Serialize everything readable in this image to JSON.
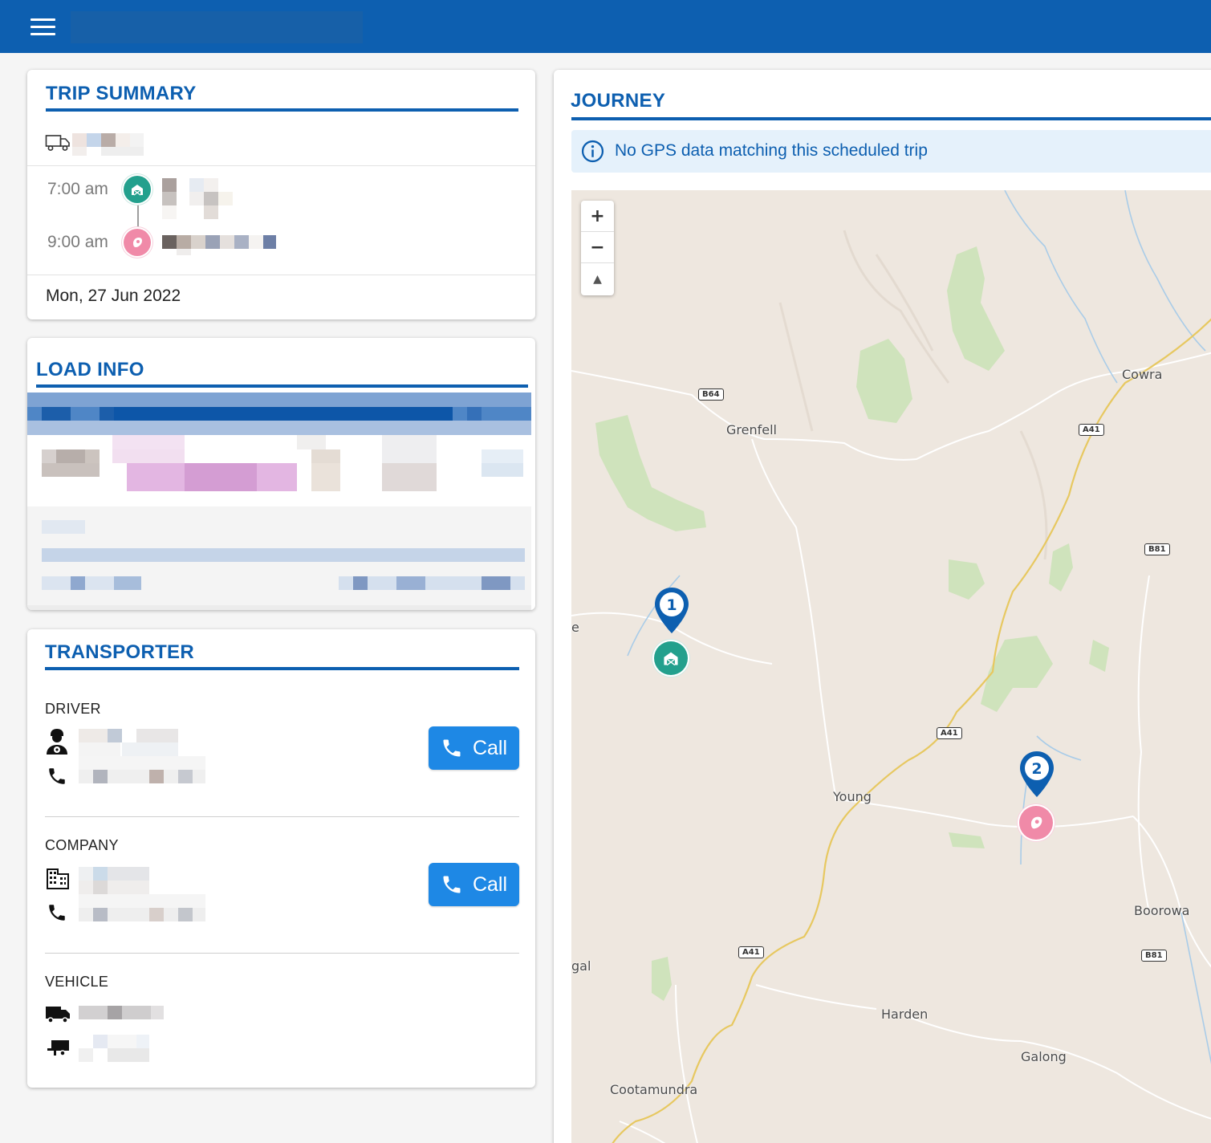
{
  "trip_summary": {
    "title": "TRIP SUMMARY",
    "departure_time": "7:00 am",
    "arrival_time": "9:00 am",
    "date": "Mon, 27 Jun 2022"
  },
  "load_info": {
    "title": "LOAD INFO"
  },
  "transporter": {
    "title": "TRANSPORTER",
    "driver_label": "DRIVER",
    "company_label": "COMPANY",
    "vehicle_label": "VEHICLE",
    "call_label": "Call"
  },
  "journey": {
    "title": "JOURNEY",
    "alert": "No GPS data matching this scheduled trip",
    "map": {
      "towns": [
        "Cowra",
        "Grenfell",
        "Young",
        "Boorowa",
        "Harden",
        "Galong",
        "Cootamundra",
        "gal",
        "e"
      ],
      "road_shields": [
        "B64",
        "A41",
        "B81",
        "A41",
        "A41",
        "B81"
      ],
      "markers": [
        "1",
        "2"
      ]
    }
  },
  "colors": {
    "primary": "#0d5fb0",
    "call_button": "#1e88e5",
    "origin": "#23a08d",
    "destination": "#f08aa8"
  }
}
